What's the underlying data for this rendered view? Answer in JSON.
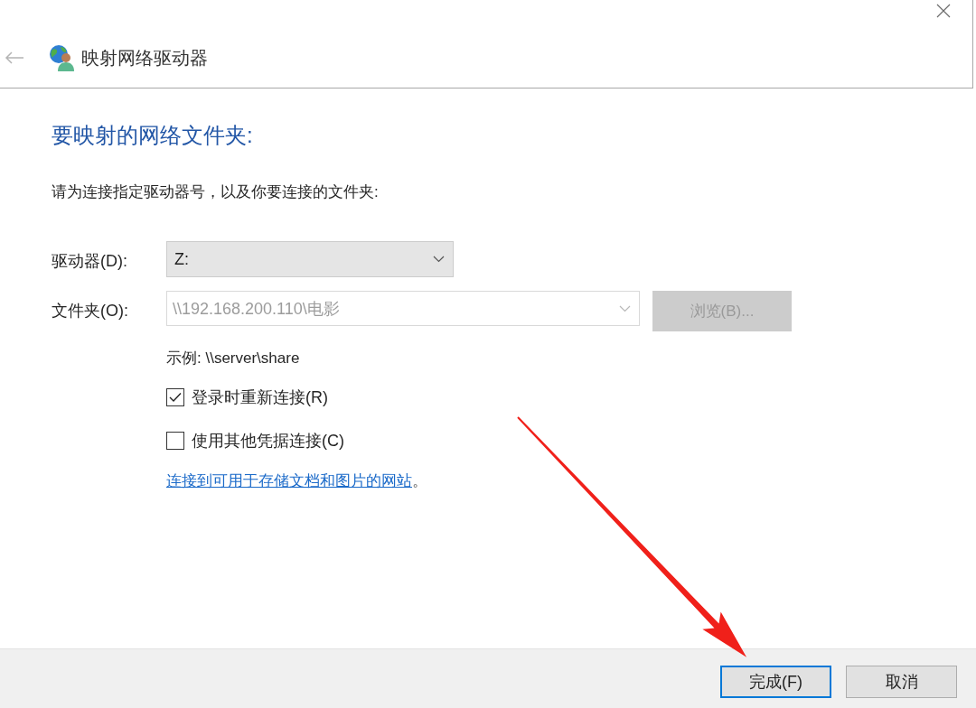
{
  "window": {
    "title": "映射网络驱动器",
    "back_button": {
      "disabled": true
    }
  },
  "heading": "要映射的网络文件夹:",
  "instruction": "请为连接指定驱动器号，以及你要连接的文件夹:",
  "fields": [
    {
      "kind": "dropdown",
      "label": "驱动器(D):",
      "value": "Z:",
      "disabled": false
    },
    {
      "kind": "combo",
      "label": "文件夹(O):",
      "value": "\\\\192.168.200.110\\电影",
      "disabled": true,
      "browse_button": {
        "label": "浏览(B)...",
        "disabled": true
      }
    }
  ],
  "example": "示例: \\\\server\\share",
  "options": [
    {
      "label": "登录时重新连接(R)",
      "checked": true
    },
    {
      "label": "使用其他凭据连接(C)",
      "checked": false
    }
  ],
  "link": {
    "text": "连接到可用于存储文档和图片的网站",
    "suffix": "。"
  },
  "buttons": [
    {
      "label": "完成(F)",
      "default": true
    },
    {
      "label": "取消",
      "default": false
    }
  ]
}
